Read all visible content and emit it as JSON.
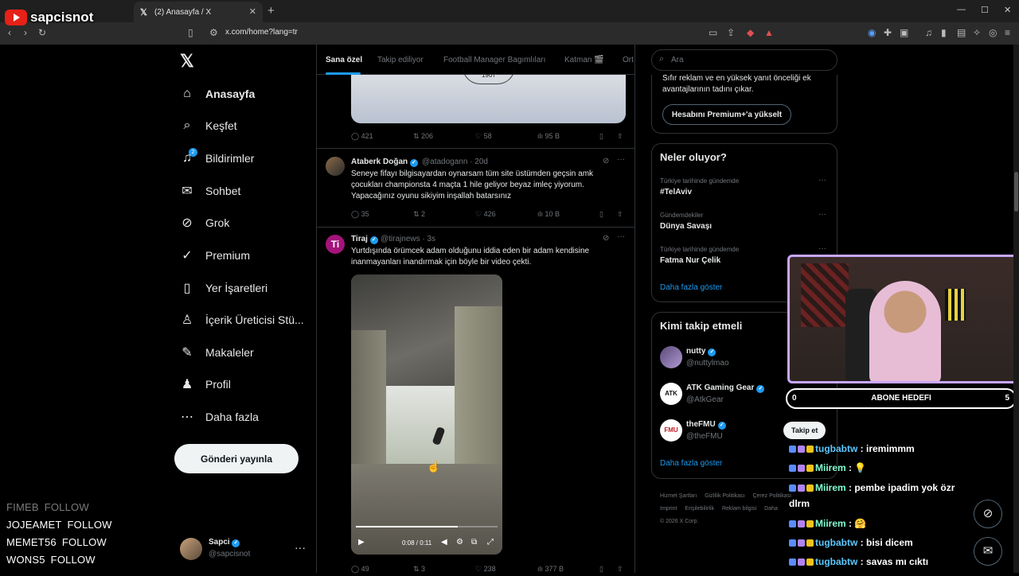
{
  "overlay": {
    "channel": "sapcisnot",
    "follow_list": [
      {
        "user": "FIMEB",
        "action": "FOLLOW"
      },
      {
        "user": "JOJEAMET",
        "action": "FOLLOW"
      },
      {
        "user": "MEMET56",
        "action": "FOLLOW"
      },
      {
        "user": "WONS5",
        "action": "FOLLOW"
      }
    ],
    "goal": {
      "left": "0",
      "label": "ABONE HEDEFI",
      "right": "5",
      "progress": 0.0
    },
    "chat": [
      {
        "user": "tugbabtw",
        "color": "#5cc8ff",
        "text": " : iremimmm"
      },
      {
        "user": "Miirem",
        "color": "#7fffd4",
        "text": " :  💡"
      },
      {
        "user": "Miirem",
        "color": "#7fffd4",
        "text": " : pembe ipadim yok özr"
      },
      {
        "user": "Miirem",
        "color": "#7fffd4",
        "text": " :  🤗"
      },
      {
        "user": "tugbabtw",
        "color": "#5cc8ff",
        "text": " : bisi dicem"
      },
      {
        "user": "tugbabtw",
        "color": "#5cc8ff",
        "text": " : savas mı cıktı"
      }
    ],
    "chat_wrap": "dlrm"
  },
  "browser": {
    "tab_title": "(2) Anasayfa / X",
    "url": "x.com/home?lang=tr"
  },
  "nav": {
    "items": [
      {
        "label": "Anasayfa",
        "icon": "home-icon",
        "glyph": "⌂"
      },
      {
        "label": "Keşfet",
        "icon": "search-icon",
        "glyph": "⌕"
      },
      {
        "label": "Bildirimler",
        "icon": "bell-icon",
        "glyph": "♫"
      },
      {
        "label": "Sohbet",
        "icon": "mail-icon",
        "glyph": "✉"
      },
      {
        "label": "Grok",
        "icon": "grok-icon",
        "glyph": "⊘"
      },
      {
        "label": "Premium",
        "icon": "premium-icon",
        "glyph": "✓"
      },
      {
        "label": "Yer İşaretleri",
        "icon": "bookmark-icon",
        "glyph": "▯"
      },
      {
        "label": "İçerik Üreticisi Stü...",
        "icon": "creator-icon",
        "glyph": "♙"
      },
      {
        "label": "Makaleler",
        "icon": "articles-icon",
        "glyph": "✎"
      },
      {
        "label": "Profil",
        "icon": "profile-icon",
        "glyph": "♟"
      },
      {
        "label": "Daha fazla",
        "icon": "more-icon",
        "glyph": "⋯"
      }
    ],
    "notif_count": "2",
    "post_label": "Gönderi yayınla",
    "profile": {
      "name": "Sapci",
      "handle": "@sapcisnot"
    }
  },
  "feed": {
    "tabs": [
      "Sana özel",
      "Takip ediliyor",
      "Football Manager Bagımlıları",
      "Katman 🎬",
      "Ort"
    ],
    "top_stats": {
      "replies": "421",
      "reposts": "206",
      "likes": "58",
      "views": "95 B"
    },
    "seal_text": "1907",
    "tweets": [
      {
        "name": "Ataberk Doğan",
        "handle": "@atadogann · 20d",
        "text": "Seneye fifayı bilgisayardan oynarsam tüm site üstümden geçsin amk çocukları championsta 4 maçta 1 hile geliyor beyaz imleç yiyorum. Yapacağınız oyunu sikiyim inşallah batarsınız",
        "replies": "35",
        "reposts": "2",
        "likes": "426",
        "views": "10 B"
      },
      {
        "name": "Tiraj",
        "handle": "@tirajnews · 3s",
        "text": "Yurtdışında örümcek adam olduğunu iddia eden bir adam kendisine inanmayanları inandırmak için böyle bir video çekti.",
        "replies": "49",
        "reposts": "3",
        "likes": "238",
        "views": "377 B",
        "video_time": "0:08 / 0:11",
        "video_progress": 0.72
      }
    ]
  },
  "right": {
    "search_placeholder": "Ara",
    "premium_text": "Sıfır reklam ve en yüksek yanıt önceliği ek avantajlarının tadını çıkar.",
    "premium_button": "Hesabını Premium+'a yükselt",
    "trends_title": "Neler oluyor?",
    "trends": [
      {
        "context": "Türkiye tarihinde gündemde",
        "name": "#TelAviv"
      },
      {
        "context": "Gündemdekiler",
        "name": "Dünya Savaşı"
      },
      {
        "context": "Türkiye tarihinde gündemde",
        "name": "Fatma Nur Çelik"
      }
    ],
    "show_more": "Daha fazla göster",
    "who_title": "Kimi takip etmeli",
    "who": [
      {
        "name": "nutty",
        "handle": "@nuttylmao",
        "avatar": ""
      },
      {
        "name": "ATK Gaming Gear",
        "handle": "@AtkGear",
        "avatar": "ATK"
      },
      {
        "name": "theFMU",
        "handle": "@theFMU",
        "avatar": "FMU"
      }
    ],
    "follow_button": "Takip et",
    "footer": [
      "Hizmet Şartları",
      "Gizlilik Politikası",
      "Çerez Politikası",
      "Imprint",
      "Erişilebilirlik",
      "Reklam bilgisi",
      "Daha",
      "© 2026 X Corp."
    ]
  },
  "colors": {
    "accent": "#1d9bf0",
    "bg": "#000000",
    "cam_border": "#c9a7ff"
  }
}
